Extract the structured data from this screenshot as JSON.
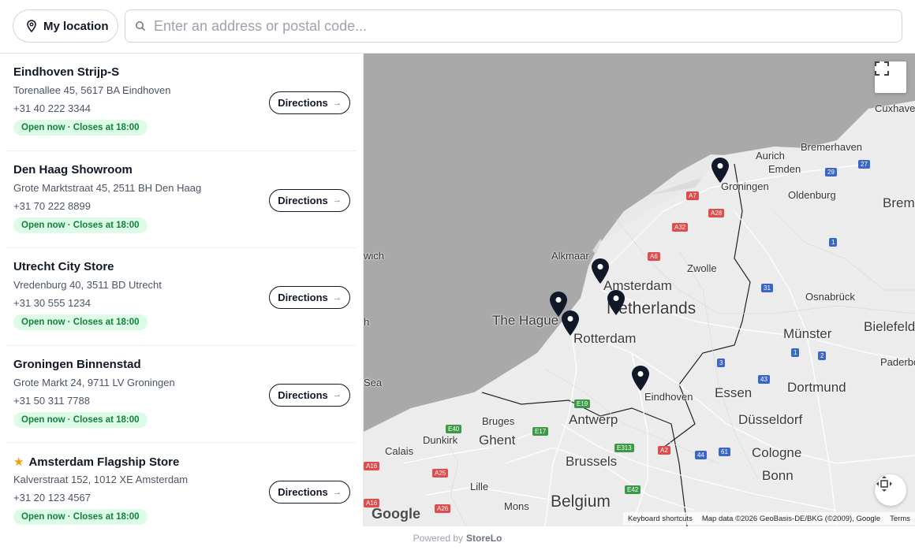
{
  "toolbar": {
    "my_location_label": "My location",
    "search_placeholder": "Enter an address or postal code...",
    "search_value": ""
  },
  "stores": [
    {
      "name": "Eindhoven Strijp-S",
      "address": "Torenallee 45, 5617 BA Eindhoven",
      "phone": "+31 40 222 3344",
      "status": "Open now · Closes at 18:00",
      "directions": "Directions",
      "featured": false
    },
    {
      "name": "Den Haag Showroom",
      "address": "Grote Marktstraat 45, 2511 BH Den Haag",
      "phone": "+31 70 222 8899",
      "status": "Open now · Closes at 18:00",
      "directions": "Directions",
      "featured": false
    },
    {
      "name": "Utrecht City Store",
      "address": "Vredenburg 40, 3511 BD Utrecht",
      "phone": "+31 30 555 1234",
      "status": "Open now · Closes at 18:00",
      "directions": "Directions",
      "featured": false
    },
    {
      "name": "Groningen Binnenstad",
      "address": "Grote Markt 24, 9711 LV Groningen",
      "phone": "+31 50 311 7788",
      "status": "Open now · Closes at 18:00",
      "directions": "Directions",
      "featured": false
    },
    {
      "name": "Amsterdam Flagship Store",
      "address": "Kalverstraat 152, 1012 XE Amsterdam",
      "phone": "+31 20 123 4567",
      "status": "Open now · Closes at 18:00",
      "directions": "Directions",
      "featured": true
    }
  ],
  "map": {
    "cities": {
      "cuxhaven": "Cuxhaven",
      "bremerhaven": "Bremerhaven",
      "aurich": "Aurich",
      "emden": "Emden",
      "groningen": "Groningen",
      "oldenburg": "Oldenburg",
      "bremen": "Brem",
      "alkmaar": "Alkmaar",
      "amsterdam": "Amsterdam",
      "zwolle": "Zwolle",
      "osnabruck": "Osnabrück",
      "the_hague": "The Hague",
      "netherlands": "Netherlands",
      "rotterdam": "Rotterdam",
      "munster": "Münster",
      "bielefeld": "Bielefeld",
      "paderborn": "Paderbo",
      "eindhoven": "Eindhoven",
      "essen": "Essen",
      "dortmund": "Dortmund",
      "dusseldorf": "Düsseldorf",
      "bruges": "Bruges",
      "antwerp": "Antwerp",
      "ghent": "Ghent",
      "calais": "Calais",
      "dunkirk": "Dunkirk",
      "brussels": "Brussels",
      "cologne": "Cologne",
      "bonn": "Bonn",
      "lille": "Lille",
      "mons": "Mons",
      "belgium": "Belgium",
      "norwich": "wich",
      "sea_a": "Sea",
      "edge_h": "h"
    },
    "roads": {
      "a7": "A7",
      "a28": "A28",
      "a32": "A32",
      "a6": "A6",
      "r29": "29",
      "r27": "27",
      "r1a": "1",
      "r31": "31",
      "r1b": "1",
      "r2": "2",
      "r3": "3",
      "r43": "43",
      "e19": "E19",
      "e40": "E40",
      "e17": "E17",
      "e313": "E313",
      "a2": "A2",
      "r44": "44",
      "r61": "61",
      "a16a": "A16",
      "a25": "A25",
      "a26": "A26",
      "a16b": "A16",
      "e42": "E42"
    },
    "google_label": "Google",
    "keyboard_shortcuts": "Keyboard shortcuts",
    "map_data": "Map data ©2026 GeoBasis-DE/BKG (©2009), Google",
    "terms": "Terms"
  },
  "footer": {
    "powered_by": "Powered by",
    "brand": "StoreLo"
  },
  "colors": {
    "accent_dark": "#111827",
    "status_bg": "#dcfce7",
    "status_text": "#15803d",
    "star": "#f59e0b"
  }
}
